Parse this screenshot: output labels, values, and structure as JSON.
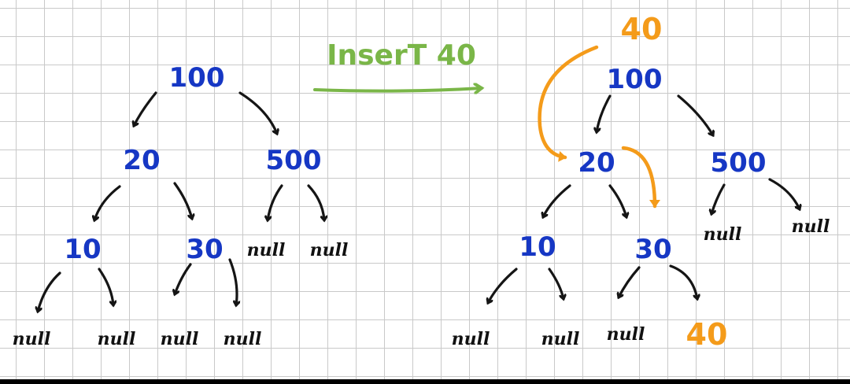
{
  "caption": "InserT 40",
  "inserted_label": "40",
  "before_tree": {
    "root": "100",
    "l1_left": "20",
    "l1_right": "500",
    "l2_a": "10",
    "l2_b": "30",
    "l2_c": "null",
    "l2_d": "null",
    "l3_a": "null",
    "l3_b": "null",
    "l3_c": "null",
    "l3_d": "null"
  },
  "after_tree": {
    "root": "100",
    "l1_left": "20",
    "l1_right": "500",
    "l2_a": "10",
    "l2_b": "30",
    "l2_c": "null",
    "l2_d": "null",
    "l3_a": "null",
    "l3_b": "null",
    "l3_c": "null",
    "l3_new": "40"
  },
  "colors": {
    "node": "#1637c4",
    "arrow": "#151515",
    "insert": "#f49b1a",
    "caption": "#7ab648"
  }
}
